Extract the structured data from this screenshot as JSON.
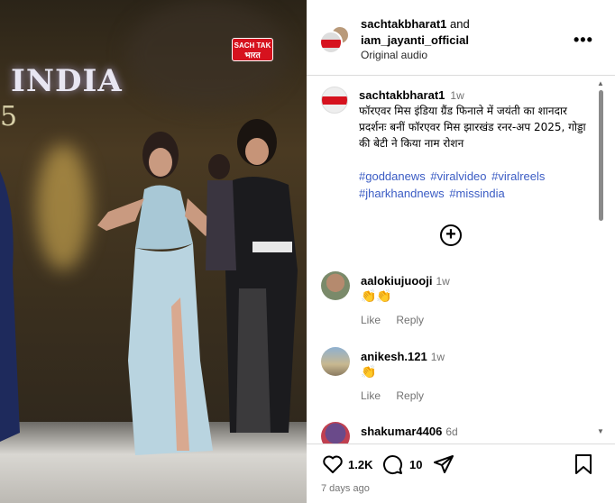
{
  "video": {
    "stage_text": "INDIA",
    "stage_number": "5",
    "channel_logo_top": "SACH TAK",
    "channel_logo_bottom": "भारत"
  },
  "header": {
    "user1": "sachtakbharat1",
    "joiner": "and",
    "user2": "iam_jayanti_official",
    "audio": "Original audio",
    "more_icon": "more-horizontal-icon"
  },
  "caption": {
    "username": "sachtakbharat1",
    "time": "1w",
    "text": "फॉरएवर मिस इंडिया ग्रैंड फिनाले में जयंती का शानदार प्रदर्शनः बनीं फॉरएवर मिस झारखंड रनर-अप 2025, गोड्डा की बेटी ने किया नाम रोशन",
    "hashtags": [
      "#goddanews",
      "#viralvideo",
      "#viralreels",
      "#jharkhandnews",
      "#missindia"
    ]
  },
  "load_more_icon": "plus-circle-icon",
  "comments": [
    {
      "user": "aalokiujuooji",
      "time": "1w",
      "text": "👏👏",
      "like": "Like",
      "reply": "Reply"
    },
    {
      "user": "anikesh.121",
      "time": "1w",
      "text": "👏",
      "like": "Like",
      "reply": "Reply"
    },
    {
      "user": "shakumar4406",
      "time": "6d"
    }
  ],
  "footer": {
    "likes": "1.2K",
    "comments": "10",
    "posted": "7 days ago",
    "icons": [
      "heart-icon",
      "comment-icon",
      "share-icon",
      "bookmark-icon"
    ]
  },
  "colors": {
    "hashtag": "#3b5cc4",
    "muted": "#737373",
    "logo_red": "#d6121e"
  }
}
